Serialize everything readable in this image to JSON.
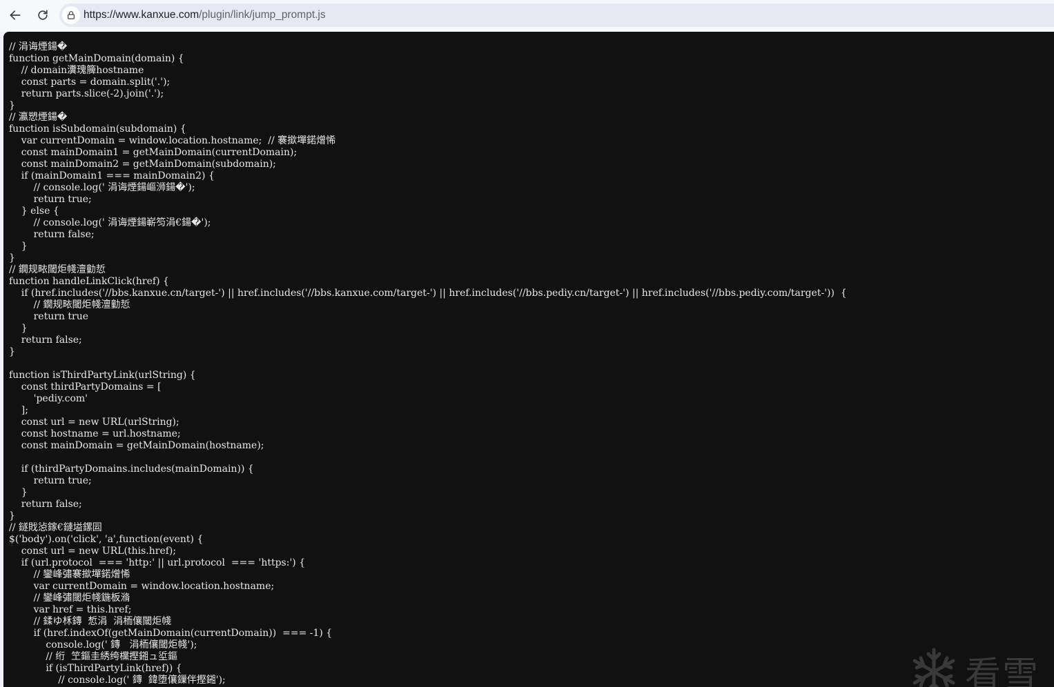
{
  "browser": {
    "url_host": "https://www.kanxue.com",
    "url_path": "/plugin/link/jump_prompt.js",
    "icons": {
      "back": "arrow-left-icon",
      "reload": "reload-icon",
      "site_info": "site-info-icon"
    }
  },
  "code_lines": [
    "// 涓诲煙鍚�",
    "function getMainDomain(domain) {",
    "    // domain瀵瑰簲hostname",
    "    const parts = domain.split('.');",
    "    return parts.slice(-2).join('.');",
    "}",
    "// 瀛愬煙鍚�",
    "function isSubdomain(subdomain) {",
    "    var currentDomain = window.location.hostname;  // 褰撳墠鍩熷悕",
    "    const mainDomain1 = getMainDomain(currentDomain);",
    "    const mainDomain2 = getMainDomain(subdomain);",
    "    if (mainDomain1 === mainDomain2) {",
    "        // console.log(' 涓诲煙鍚嶇浉鍚�');",
    "        return true;",
    "    } else {",
    "        // console.log(' 涓诲煙鍚嶄笉涓€鍚�');",
    "        return false;",
    "    }",
    "}",
    "// 鐗规畩閾炬帴澶勭悊",
    "function handleLinkClick(href) {",
    "    if (href.includes('//bbs.kanxue.cn/target-') || href.includes('//bbs.kanxue.com/target-') || href.includes('//bbs.pediy.cn/target-') || href.includes('//bbs.pediy.com/target-'))  {",
    "        // 鐗规畩閾炬帴澶勭悊",
    "        return true",
    "    }",
    "    return false;",
    "}",
    "",
    "function isThirdPartyLink(urlString) {",
    "    const thirdPartyDomains = [",
    "        'pediy.com'",
    "    ];",
    "    const url = new URL(urlString);",
    "    const hostname = url.hostname;",
    "    const mainDomain = getMainDomain(hostname);",
    "",
    "    if (thirdPartyDomains.includes(mainDomain)) {",
    "        return true;",
    "    }",
    "    return false;",
    "}",
    "// 鐩戝惉鎵€鏈塧鏍囩",
    "$('body').on('click', 'a',function(event) {",
    "    const url = new URL(this.href);",
    "    if (url.protocol  === 'http:' || url.protocol  === 'https:') {",
    "        // 鑾峰彇褰撳墠鍩熷悕",
    "        var currentDomain = window.location.hostname;",
    "        // 鑾峰彇閾炬帴鍦板潃",
    "        var href = this.href;",
    "        // 鍒ゆ柇鏄  惁涓  涓栭儴閾炬帴",
    "        if (href.indexOf(getMainDomain(currentDomain))  === -1) {",
    "            console.log(' 鏄   涓栭儴閾炬帴');",
    "            // 绗  笁鏂圭綉绔欓摼鎺ュ垽鏂",
    "            if (isThirdPartyLink(href)) {",
    "                // console.log(' 鏄  鍏堕儴鏁伴摼鎺');"
  ],
  "watermark": {
    "text": "看雪",
    "icon": "snowflake-logo-icon"
  }
}
